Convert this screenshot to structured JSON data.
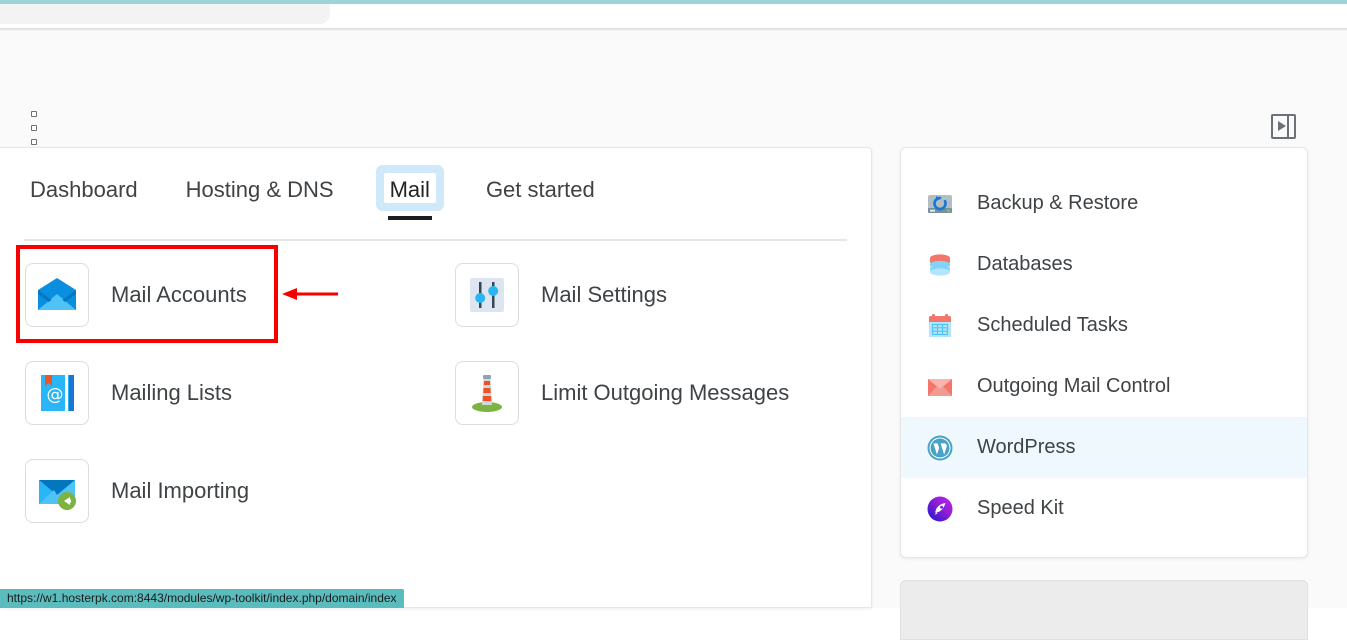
{
  "browser": {
    "accent_color": "#9ed3d6",
    "status_bar": {
      "url": "https://w1.hosterpk.com:8443/modules/wp-toolkit/index.php/domain/index",
      "background_color": "#5bbcbe"
    }
  },
  "toolbar": {
    "kebab_menu_name": "More actions",
    "panel_toggle_name": "Toggle side panel"
  },
  "tabs": [
    {
      "label": "Dashboard",
      "active": false
    },
    {
      "label": "Hosting & DNS",
      "active": false
    },
    {
      "label": "Mail",
      "active": true
    },
    {
      "label": "Get started",
      "active": false
    }
  ],
  "tiles": {
    "left_column": [
      {
        "label": "Mail Accounts",
        "icon": "open-envelope-icon",
        "highlighted": true
      },
      {
        "label": "Mailing Lists",
        "icon": "address-book-at-icon",
        "highlighted": false
      },
      {
        "label": "Mail Importing",
        "icon": "envelope-import-icon",
        "highlighted": false
      }
    ],
    "right_column": [
      {
        "label": "Mail Settings",
        "icon": "sliders-icon",
        "highlighted": false
      },
      {
        "label": "Limit Outgoing Messages",
        "icon": "lighthouse-icon",
        "highlighted": false
      }
    ]
  },
  "sidebar": {
    "items": [
      {
        "label": "Backup & Restore",
        "icon": "hard-drive-restore-icon",
        "hover": false
      },
      {
        "label": "Databases",
        "icon": "database-icon",
        "hover": false
      },
      {
        "label": "Scheduled Tasks",
        "icon": "calendar-icon",
        "hover": false
      },
      {
        "label": "Outgoing Mail Control",
        "icon": "envelope-red-icon",
        "hover": false
      },
      {
        "label": "WordPress",
        "icon": "wordpress-icon",
        "hover": true
      },
      {
        "label": "Speed Kit",
        "icon": "rocket-icon",
        "hover": false
      }
    ],
    "hover_color": "#eef8fd"
  },
  "annotation": {
    "color": "#f90000",
    "target": "Mail Accounts",
    "arrow_direction": "left"
  }
}
